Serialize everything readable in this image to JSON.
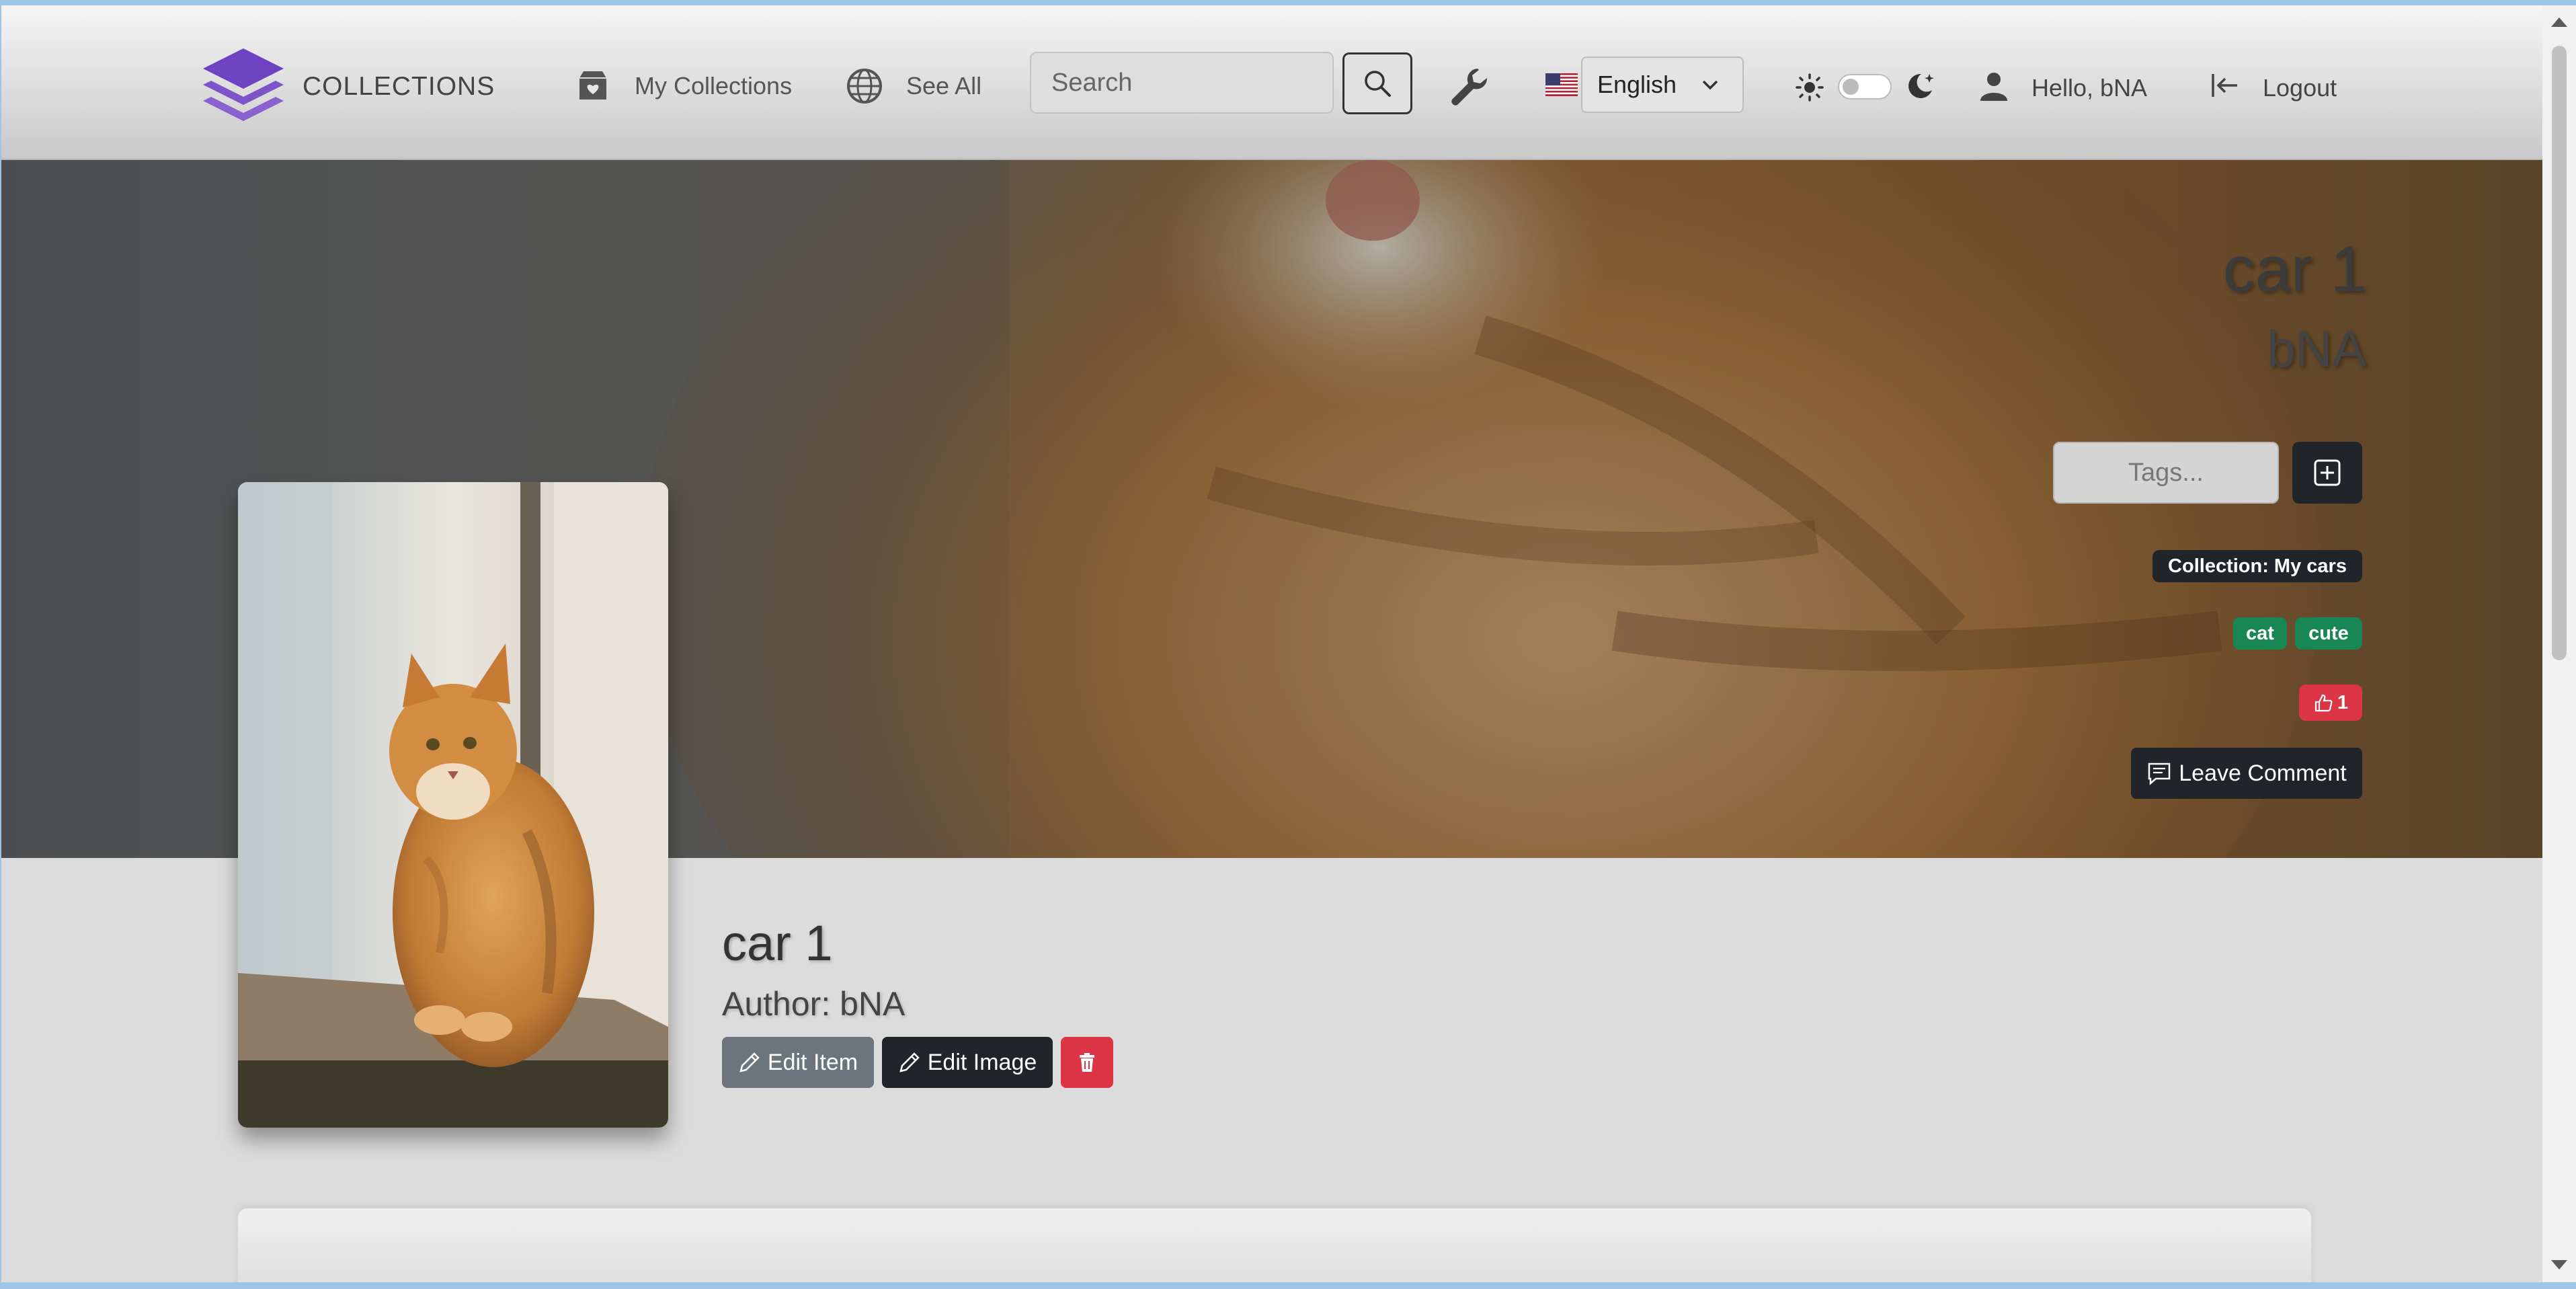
{
  "navbar": {
    "brand": "COLLECTIONS",
    "my_collections": "My Collections",
    "see_all": "See All",
    "search_placeholder": "Search",
    "language": "English",
    "greeting": "Hello, bNA",
    "logout": "Logout"
  },
  "hero": {
    "title": "car 1",
    "author": "bNA",
    "tags_placeholder": "Tags...",
    "collection_badge": "Collection: My cars",
    "tags": [
      "cat",
      "cute"
    ],
    "likes": "1",
    "comment_button": "Leave Comment"
  },
  "item": {
    "title": "car 1",
    "author": "Author: bNA",
    "edit_item": "Edit Item",
    "edit_image": "Edit Image"
  },
  "colors": {
    "accent": "#6f42c1",
    "dark": "#212529",
    "success": "#198754",
    "danger": "#dc3545",
    "secondary": "#6c757d"
  },
  "icons": [
    "layers-logo-icon",
    "box-heart-icon",
    "globe-icon",
    "search-icon",
    "wrench-icon",
    "us-flag-icon",
    "chevron-down-icon",
    "sun-icon",
    "moon-icon",
    "user-icon",
    "logout-icon",
    "plus-square-icon",
    "hand-thumbs-up-icon",
    "chat-icon",
    "pencil-icon",
    "trash-icon"
  ]
}
